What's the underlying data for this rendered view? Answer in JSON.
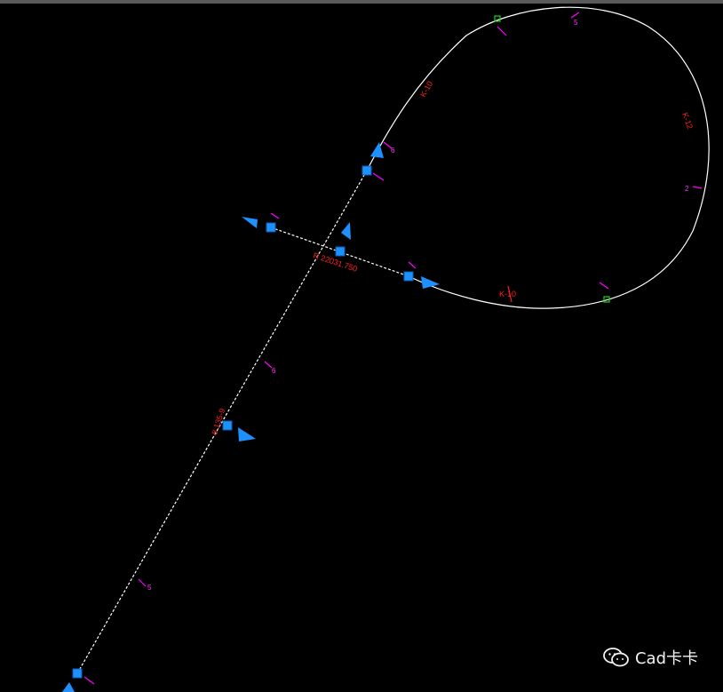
{
  "drawing": {
    "background_color": "#000000",
    "curve_color": "#ffffff",
    "grip_color": "#1e90ff",
    "node_color": "#1fd31f",
    "tick_color": "#ff00ff",
    "label_color": "#ff2020",
    "grip_readout": "R 22031.750",
    "vertical_station": "8.135-9",
    "red_labels": [
      "K-10",
      "K-12",
      "K-10"
    ],
    "magenta_labels": [
      "5",
      "2",
      "6",
      "6",
      "5"
    ]
  },
  "watermark": {
    "text": "Cad卡卡",
    "icon": "wechat-icon"
  }
}
